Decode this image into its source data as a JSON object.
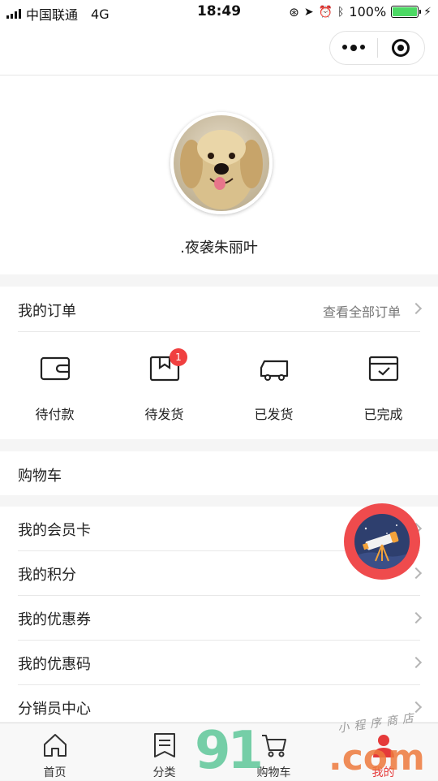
{
  "status_bar": {
    "carrier": "中国联通",
    "network": "4G",
    "time": "18:49",
    "battery": "100%"
  },
  "profile": {
    "nickname": ".夜袭朱丽叶",
    "avatar": "golden-retriever-photo"
  },
  "orders": {
    "title": "我的订单",
    "view_all": "查看全部订单",
    "items": [
      {
        "label": "待付款",
        "icon": "wallet-icon"
      },
      {
        "label": "待发货",
        "icon": "box-icon",
        "badge": "1"
      },
      {
        "label": "已发货",
        "icon": "truck-icon"
      },
      {
        "label": "已完成",
        "icon": "completed-box-icon"
      }
    ]
  },
  "cart": {
    "title": "购物车"
  },
  "menu": {
    "items": [
      {
        "label": "我的会员卡"
      },
      {
        "label": "我的积分"
      },
      {
        "label": "我的优惠券"
      },
      {
        "label": "我的优惠码"
      },
      {
        "label": "分销员中心"
      }
    ]
  },
  "tabbar": {
    "items": [
      {
        "label": "首页",
        "icon": "home-icon"
      },
      {
        "label": "分类",
        "icon": "category-icon"
      },
      {
        "label": "购物车",
        "icon": "cart-icon"
      },
      {
        "label": "我的",
        "icon": "user-icon",
        "active": true
      }
    ]
  },
  "watermark": {
    "brand": "91",
    "domain": ".com",
    "subtitle": "小程序商店"
  },
  "colors": {
    "accent": "#e53a3a",
    "badge": "#f04040",
    "float_button": "#ef4b4d",
    "battery": "#4cd964"
  }
}
